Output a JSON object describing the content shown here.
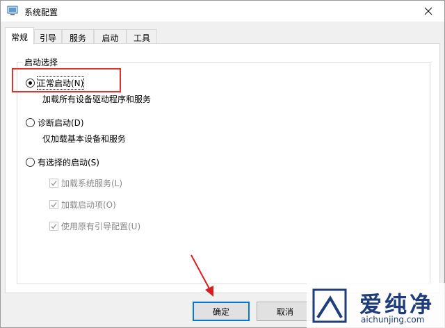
{
  "window": {
    "title": "系统配置"
  },
  "tabs": [
    {
      "label": "常规"
    },
    {
      "label": "引导"
    },
    {
      "label": "服务"
    },
    {
      "label": "启动"
    },
    {
      "label": "工具"
    }
  ],
  "startup_group": {
    "label": "启动选择",
    "normal": {
      "label": "正常启动(N)",
      "description": "加载所有设备驱动程序和服务",
      "checked": true
    },
    "diagnostic": {
      "label": "诊断启动(D)",
      "description": "仅加载基本设备和服务",
      "checked": false
    },
    "selective": {
      "label": "有选择的启动(S)",
      "checked": false,
      "options": [
        {
          "label": "加载系统服务(L)",
          "checked": true,
          "enabled": false
        },
        {
          "label": "加载启动项(O)",
          "checked": true,
          "enabled": false
        },
        {
          "label": "使用原有引导配置(U)",
          "checked": true,
          "enabled": false
        }
      ]
    }
  },
  "buttons": {
    "ok": "确定",
    "cancel": "取消"
  },
  "watermark": {
    "name": "爱纯净",
    "url": "aichunjing.com"
  },
  "colors": {
    "highlight": "#e03030",
    "accent": "#0078d7",
    "watermark": "#1f3d7a"
  }
}
